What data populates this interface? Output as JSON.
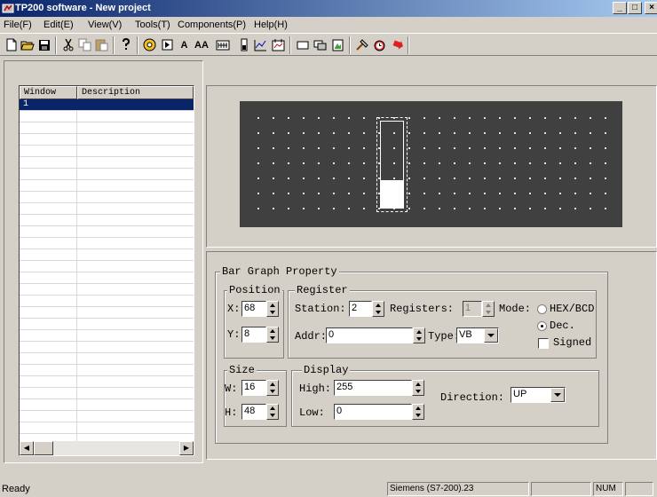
{
  "window": {
    "title": "TP200 software - New project",
    "controls": [
      "_",
      "□",
      "×"
    ]
  },
  "menu": [
    "File(F)",
    "Edit(E)",
    "View(V)",
    "Tools(T)",
    "Components(P)",
    "Help(H)"
  ],
  "toolbar": {
    "text_tool": "A",
    "text_tool_large": "AA"
  },
  "window_list": {
    "columns": [
      "Window",
      "Description"
    ],
    "rows": [
      {
        "window": "1",
        "description": ""
      }
    ]
  },
  "bar_graph": {
    "fill_fraction": 0.33
  },
  "property": {
    "title": "Bar Graph Property",
    "position": {
      "label": "Position",
      "x_label": "X:",
      "x_value": "68",
      "y_label": "Y:",
      "y_value": "8"
    },
    "register": {
      "label": "Register",
      "station_label": "Station:",
      "station_value": "2",
      "registers_label": "Registers:",
      "registers_value": "1",
      "addr_label": "Addr:",
      "addr_value": "0",
      "type_label": "Type:",
      "type_value": "VB",
      "mode_label": "Mode:",
      "mode_hex": "HEX/BCD",
      "mode_dec": "Dec.",
      "signed_label": "Signed"
    },
    "size": {
      "label": "Size",
      "w_label": "W:",
      "w_value": "16",
      "h_label": "H:",
      "h_value": "48"
    },
    "display": {
      "label": "Display",
      "high_label": "High:",
      "high_value": "255",
      "low_label": "Low:",
      "low_value": "0",
      "direction_label": "Direction:",
      "direction_value": "UP"
    }
  },
  "status": {
    "ready": "Ready",
    "plc": "Siemens (S7-200).23",
    "num": "NUM"
  }
}
